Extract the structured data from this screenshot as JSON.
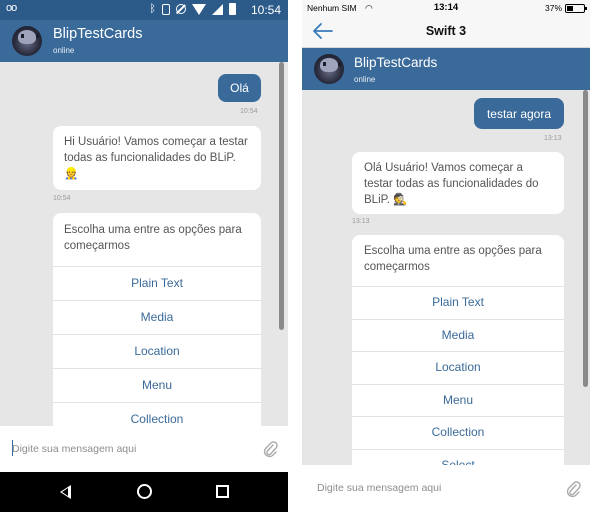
{
  "android": {
    "status": {
      "time": "10:54",
      "voicemail": "oo"
    },
    "header": {
      "title": "BlipTestCards",
      "subtitle": "online"
    },
    "messages": {
      "sent": {
        "text": "Olá",
        "time": "10:54"
      },
      "received": {
        "text": "Hi Usuário! Vamos começar a testar todas as funcionalidades do BLiP. 👷",
        "time": "10:54"
      }
    },
    "card": {
      "prompt": "Escolha uma entre as opções para começarmos",
      "options": [
        "Plain Text",
        "Media",
        "Location",
        "Menu",
        "Collection"
      ]
    },
    "input": {
      "placeholder": "Digite sua mensagem aqui"
    }
  },
  "ios": {
    "status": {
      "carrier": "Nenhum SIM",
      "time": "13:14",
      "battery": "37%"
    },
    "nav": {
      "title": "Swift 3"
    },
    "header": {
      "title": "BlipTestCards",
      "subtitle": "online"
    },
    "messages": {
      "sent": {
        "text": "testar agora",
        "time": "13:13"
      },
      "received": {
        "text": "Olá Usuário! Vamos começar a testar todas as funcionalidades do BLiP. 🕵",
        "time": "13:13"
      }
    },
    "card": {
      "prompt": "Escolha uma entre as opções para começarmos",
      "options": [
        "Plain Text",
        "Media",
        "Location",
        "Menu",
        "Collection",
        "Select"
      ]
    },
    "input": {
      "placeholder": "Digite sua mensagem aqui"
    }
  },
  "colors": {
    "brand": "#3a6a99",
    "status_bar": "#2c5b8a",
    "chat_bg": "#e6e6e6"
  },
  "icons": [
    "voicemail-icon",
    "bluetooth-icon",
    "vibrate-icon",
    "wifi-icon",
    "signal-icon",
    "battery-icon",
    "back-arrow-icon",
    "paperclip-icon",
    "nav-back-icon",
    "nav-home-icon",
    "nav-recent-icon"
  ]
}
